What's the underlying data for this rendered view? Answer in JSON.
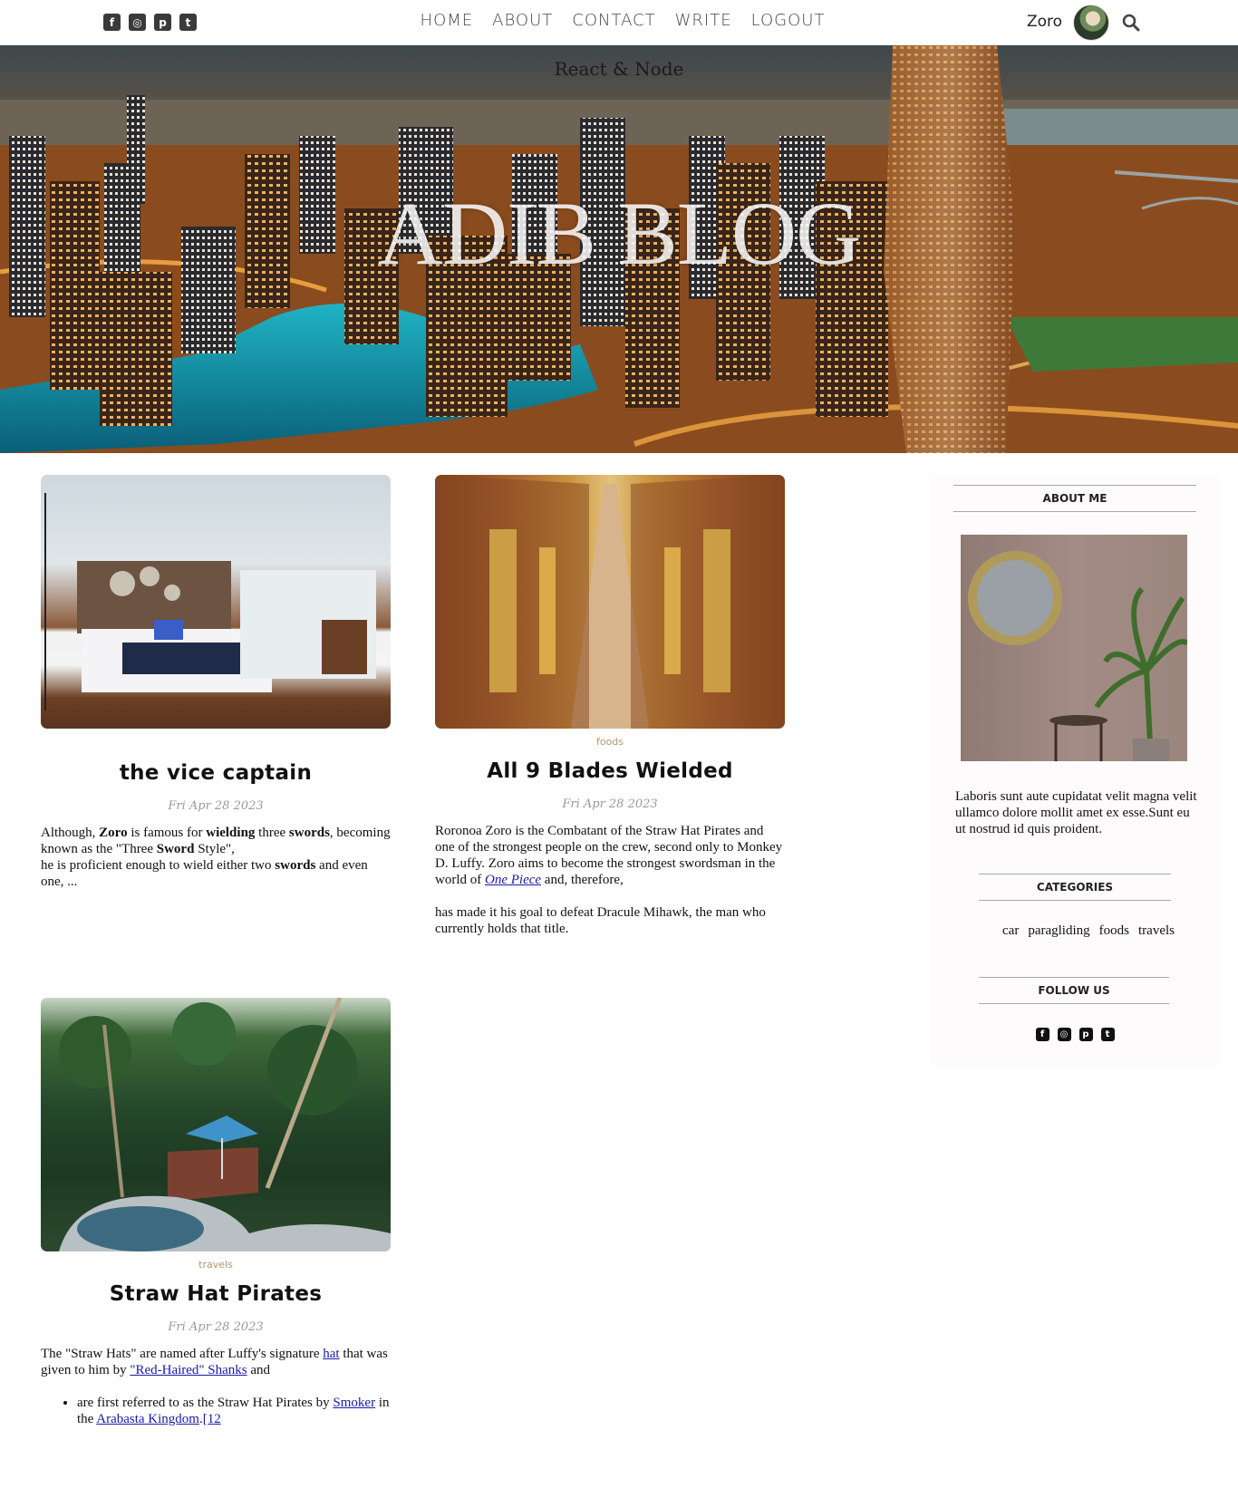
{
  "topbar": {
    "social_icons": [
      "facebook-icon",
      "instagram-icon",
      "pinterest-icon",
      "twitter-icon"
    ],
    "nav": [
      "HOME",
      "ABOUT",
      "CONTACT",
      "WRITE",
      "LOGOUT"
    ],
    "username": "Zoro"
  },
  "hero": {
    "subtitle": "React & Node",
    "title": "ADIB BLOG"
  },
  "posts": [
    {
      "category": "",
      "title": "the vice captain",
      "date": "Fri Apr 28 2023",
      "desc": {
        "p1_a": "Although, ",
        "p1_b": "Zoro",
        "p1_c": " is famous for ",
        "p1_d": "wielding",
        "p1_e": " three ",
        "p1_f": "swords",
        "p1_g": ", becoming known as the \"Three ",
        "p1_h": "Sword",
        "p1_i": " Style\",",
        "p2_a": " he is proficient enough to wield either two ",
        "p2_b": "swords",
        "p2_c": " and even one, ..."
      }
    },
    {
      "category": "foods",
      "title": "All 9 Blades Wielded",
      "date": "Fri Apr 28 2023",
      "desc": {
        "p1_a": "Roronoa Zoro is the Combatant of the Straw Hat Pirates and one of the strongest people on the crew, second only to Monkey D. Luffy. Zoro aims to become the strongest swordsman in the world of ",
        "p1_link": "One Piece",
        "p1_b": " and, therefore,",
        "p2": "has made it his goal to defeat Dracule Mihawk, the man who currently holds that title."
      }
    },
    {
      "category": "travels",
      "title": "Straw Hat Pirates",
      "date": "Fri Apr 28 2023",
      "desc": {
        "p1_a": "The \"Straw Hats\" are named after Luffy's signature ",
        "p1_link1": "hat",
        "p1_b": " that was given to him by ",
        "p1_link2": "\"Red-Haired\" Shanks",
        "p1_c": " and",
        "li_a": " are first referred to as the Straw Hat Pirates by ",
        "li_link1": "Smoker",
        "li_b": " in the ",
        "li_link2": "Arabasta Kingdom",
        "li_c": ".",
        "li_link3": "[12"
      }
    }
  ],
  "sidebar": {
    "about_heading": "ABOUT ME",
    "about_text": "Laboris sunt aute cupidatat velit magna velit ullamco dolore mollit amet ex esse.Sunt eu ut nostrud id quis proident.",
    "categories_heading": "CATEGORIES",
    "categories": [
      "car",
      "paragliding",
      "foods",
      "travels"
    ],
    "follow_heading": "FOLLOW US",
    "social_icons": [
      "facebook-icon",
      "instagram-icon",
      "pinterest-icon",
      "twitter-icon"
    ]
  },
  "colors": {
    "category": "#b2966a",
    "date": "#9a9a9a",
    "link": "#1a1aa6",
    "sidebar_bg": "#fdfbfb"
  }
}
